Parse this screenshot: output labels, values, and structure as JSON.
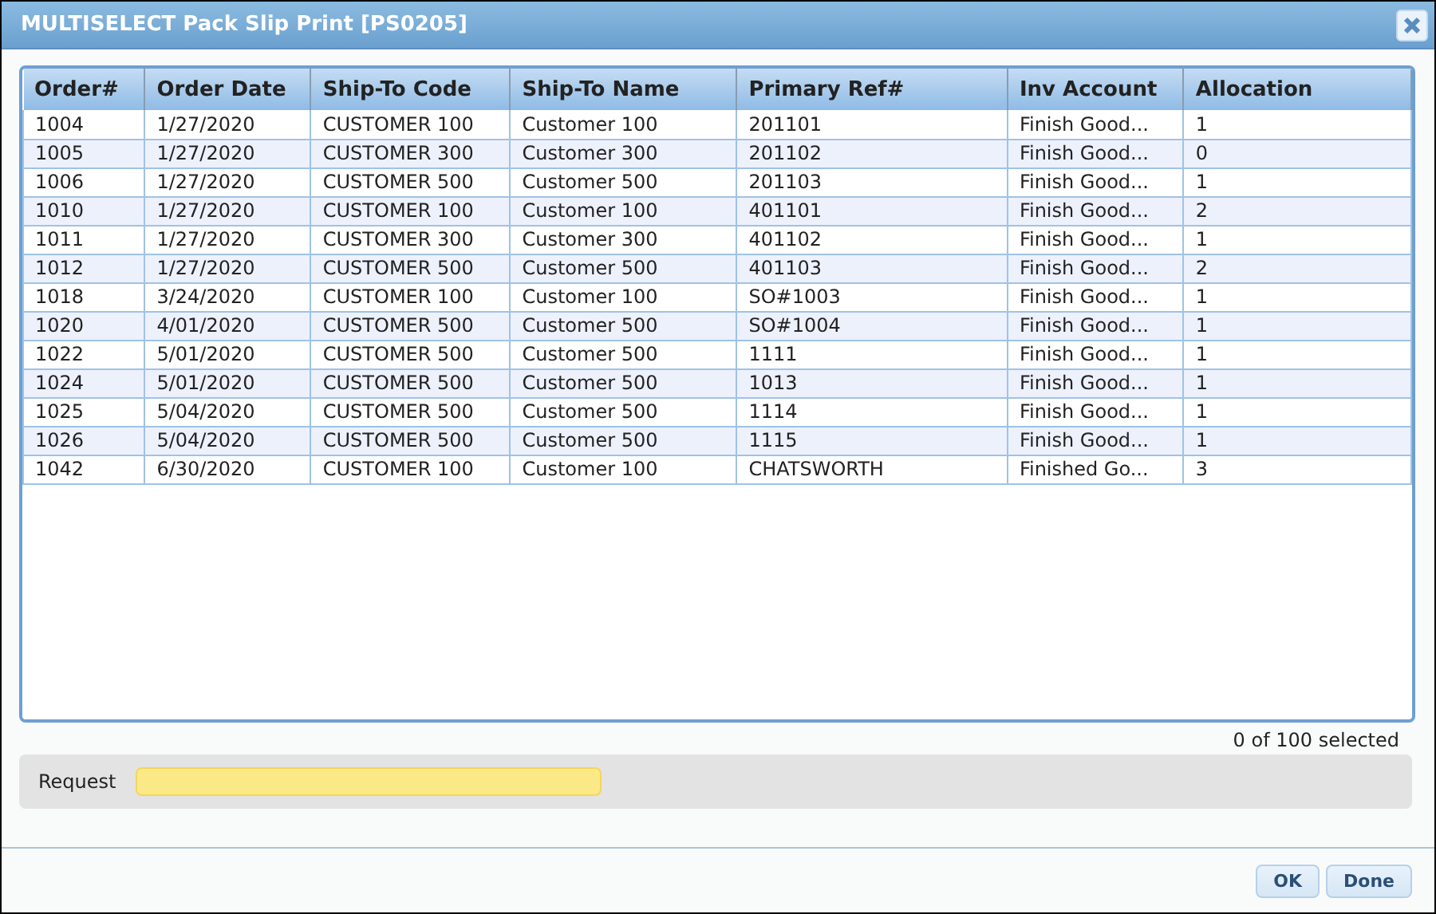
{
  "window": {
    "title": "MULTISELECT Pack Slip Print [PS0205]"
  },
  "table": {
    "columns": [
      "Order#",
      "Order Date",
      "Ship-To Code",
      "Ship-To Name",
      "Primary Ref#",
      "Inv Account",
      "Allocation"
    ],
    "rows": [
      [
        "1004",
        "1/27/2020",
        "CUSTOMER 100",
        "Customer 100",
        "201101",
        "Finish Good...",
        "1"
      ],
      [
        "1005",
        "1/27/2020",
        "CUSTOMER 300",
        "Customer 300",
        "201102",
        "Finish Good...",
        "0"
      ],
      [
        "1006",
        "1/27/2020",
        "CUSTOMER 500",
        "Customer 500",
        "201103",
        "Finish Good...",
        "1"
      ],
      [
        "1010",
        "1/27/2020",
        "CUSTOMER 100",
        "Customer 100",
        "401101",
        "Finish Good...",
        "2"
      ],
      [
        "1011",
        "1/27/2020",
        "CUSTOMER 300",
        "Customer 300",
        "401102",
        "Finish Good...",
        "1"
      ],
      [
        "1012",
        "1/27/2020",
        "CUSTOMER 500",
        "Customer 500",
        "401103",
        "Finish Good...",
        "2"
      ],
      [
        "1018",
        "3/24/2020",
        "CUSTOMER 100",
        "Customer 100",
        "SO#1003",
        "Finish Good...",
        "1"
      ],
      [
        "1020",
        "4/01/2020",
        "CUSTOMER 500",
        "Customer 500",
        "SO#1004",
        "Finish Good...",
        "1"
      ],
      [
        "1022",
        "5/01/2020",
        "CUSTOMER 500",
        "Customer 500",
        "1111",
        "Finish Good...",
        "1"
      ],
      [
        "1024",
        "5/01/2020",
        "CUSTOMER 500",
        "Customer 500",
        "1013",
        "Finish Good...",
        "1"
      ],
      [
        "1025",
        "5/04/2020",
        "CUSTOMER 500",
        "Customer 500",
        "1114",
        "Finish Good...",
        "1"
      ],
      [
        "1026",
        "5/04/2020",
        "CUSTOMER 500",
        "Customer 500",
        "1115",
        "Finish Good...",
        "1"
      ],
      [
        "1042",
        "6/30/2020",
        "CUSTOMER 100",
        "Customer 100",
        "CHATSWORTH",
        "Finished Go...",
        "3"
      ]
    ]
  },
  "selection_count": "0 of 100 selected",
  "request": {
    "label": "Request"
  },
  "buttons": [
    "OK",
    "Done"
  ]
}
